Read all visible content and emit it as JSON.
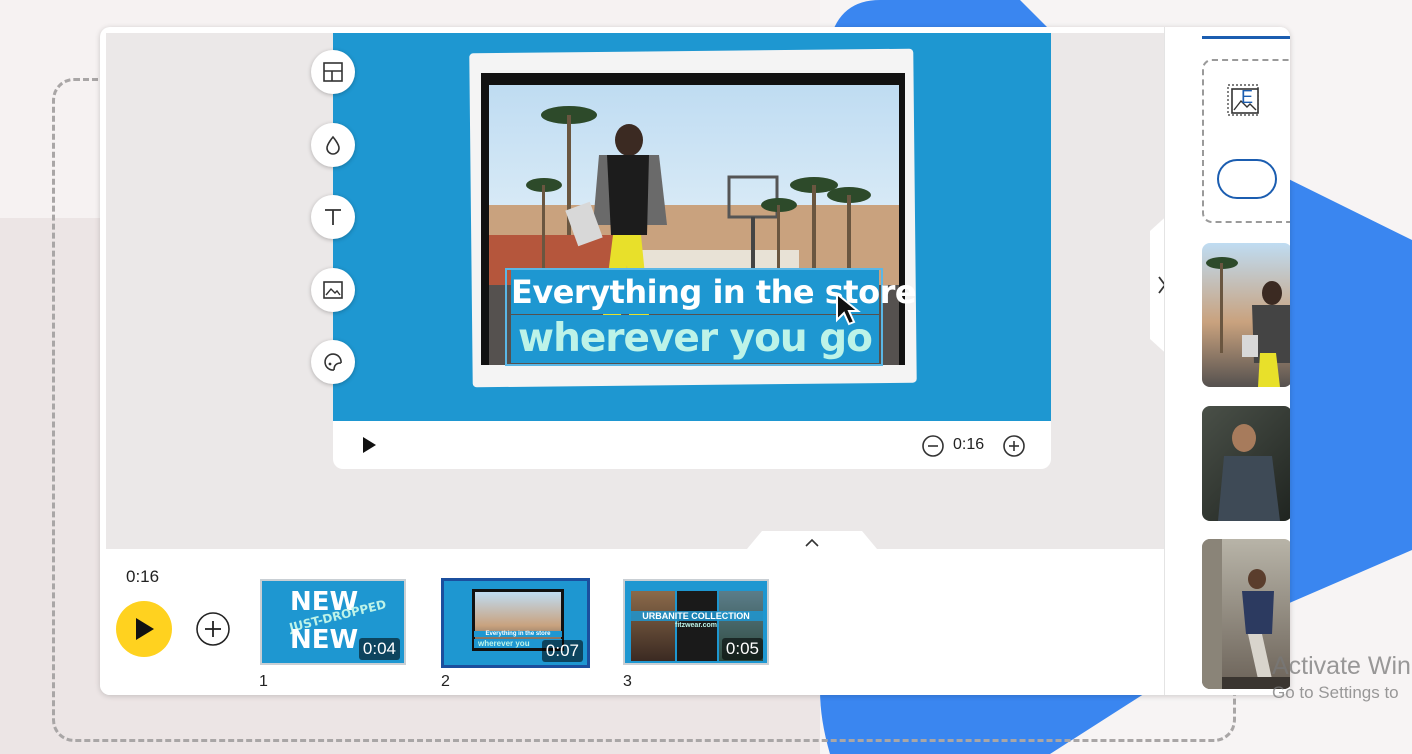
{
  "canvas": {
    "caption_line1": "Everything in the store",
    "caption_line2": "wherever you go",
    "bg_color": "#1e97d1"
  },
  "tools": [
    {
      "name": "layout-icon"
    },
    {
      "name": "color-drop-icon"
    },
    {
      "name": "text-icon"
    },
    {
      "name": "image-icon"
    },
    {
      "name": "sticker-icon"
    }
  ],
  "player": {
    "duration": "0:16",
    "play_icon": "play-icon",
    "zoom_out_icon": "minus-circle-icon",
    "zoom_in_icon": "plus-circle-icon"
  },
  "timeline": {
    "total_time": "0:16",
    "scenes": [
      {
        "number": "1",
        "duration": "0:04",
        "text_a": "NEW",
        "text_b": "JUST-DROPPED",
        "text_c": "NEW",
        "selected": false
      },
      {
        "number": "2",
        "duration": "0:07",
        "text_a": "Everything in the store",
        "text_b": "wherever you",
        "selected": true
      },
      {
        "number": "3",
        "duration": "0:05",
        "text_a": "URBANITE COLLECTION",
        "text_b": "fitzwear.com",
        "selected": false
      }
    ]
  },
  "side_panel": {
    "upload_label": "E",
    "upload_icon": "image-icon"
  },
  "watermark": {
    "line1": "Activate Win",
    "line2": "Go to Settings to"
  },
  "colors": {
    "accent_blue": "#1b5db0",
    "play_yellow": "#ffd21f",
    "brand_blue": "#3a86f0"
  }
}
